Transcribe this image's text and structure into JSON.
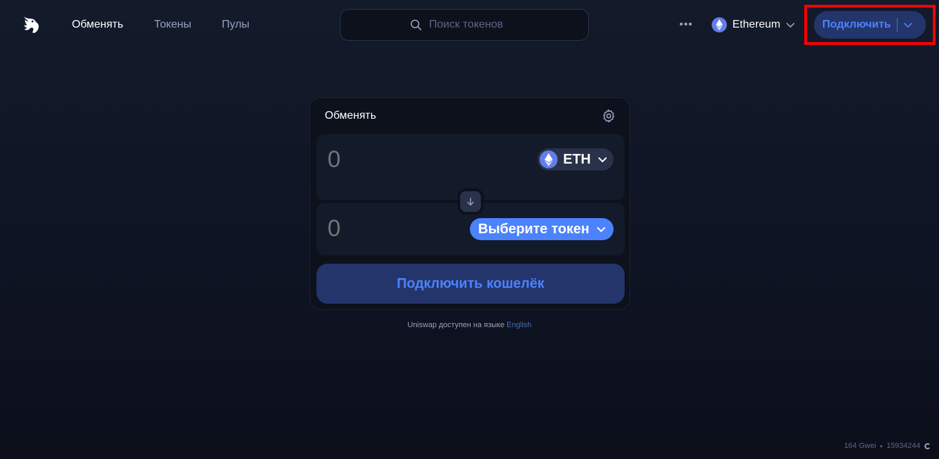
{
  "nav": {
    "logo": "uniswap-unicorn-icon",
    "links": [
      {
        "label": "Обменять",
        "active": true
      },
      {
        "label": "Токены",
        "active": false
      },
      {
        "label": "Пулы",
        "active": false
      }
    ],
    "search_placeholder": "Поиск токенов",
    "more_icon": "more-dots-icon",
    "network_label": "Ethereum",
    "connect_label": "Подключить"
  },
  "swap": {
    "title": "Обменять",
    "input_amount_placeholder": "0",
    "input_token": "ETH",
    "output_amount_placeholder": "0",
    "output_select_label": "Выберите токен",
    "cta_label": "Подключить кошелёк"
  },
  "footer_note": {
    "text": "Uniswap доступен на языке",
    "link": "English"
  },
  "status": {
    "gas": "164 Gwei",
    "block": "15934244"
  },
  "colors": {
    "accent": "#4c82fb",
    "accent_soft": "#24356b",
    "highlight": "#ff0000",
    "eth": "#627eea"
  }
}
